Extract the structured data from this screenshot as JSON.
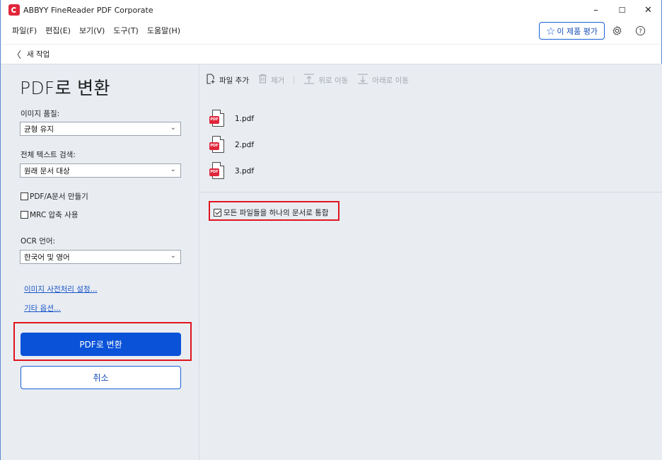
{
  "window": {
    "title": "ABBYY FineReader PDF Corporate",
    "controls": {
      "minimize": "–",
      "maximize": "☐",
      "close": "✕"
    }
  },
  "menu": [
    "파일(F)",
    "편집(E)",
    "보기(V)",
    "도구(T)",
    "도움말(H)"
  ],
  "header": {
    "rate_label": "이 제품 평가",
    "settings_icon": "gear-icon",
    "help_icon": "help-icon"
  },
  "nav": {
    "back_label": "새 작업"
  },
  "left_panel": {
    "title": "PDF로 변환",
    "image_quality": {
      "label": "이미지 품질:",
      "value": "균형 유지"
    },
    "fulltext_search": {
      "label": "전체 텍스트 검색:",
      "value": "원래 문서 대상"
    },
    "pdfa": {
      "label": "PDF/A문서 만들기",
      "checked": false
    },
    "mrc": {
      "label": "MRC 압축 사용",
      "checked": false
    },
    "ocr_language": {
      "label": "OCR 언어:",
      "value": "한국어 및 영어"
    },
    "links": {
      "preprocess": "이미지 사전처리 설정...",
      "other_options": "기타 옵션..."
    },
    "convert_button": "PDF로 변환",
    "cancel_button": "취소"
  },
  "right_panel": {
    "toolbar": {
      "add_file": "파일 추가",
      "remove": "제거",
      "move_up": "위로 이동",
      "move_down": "아래로 이동"
    },
    "files": [
      "1.pdf",
      "2.pdf",
      "3.pdf"
    ],
    "pdf_badge": "PDF",
    "merge": {
      "label": "모든 파일들을 하나의 문서로 통합",
      "checked": true
    }
  },
  "colors": {
    "accent": "#0a52d8",
    "highlight": "#e0141e",
    "panel_bg": "#e9edf2"
  }
}
